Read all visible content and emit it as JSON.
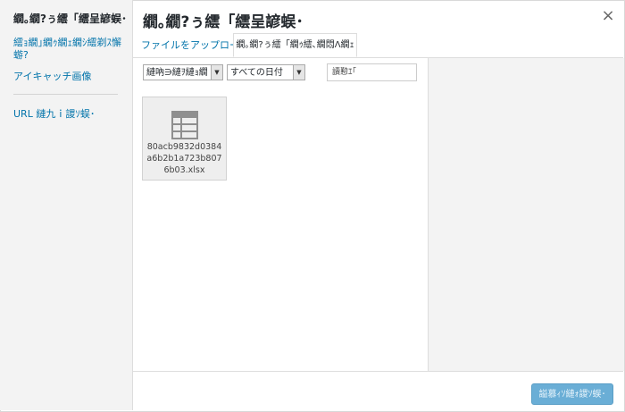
{
  "sidebar": {
    "title": "繝｡繝?ぅ繧「繧呈諺蜈･",
    "links": [
      "繧ｮ繝｣繝ｩ繝ｪ繝ｼ繧剃ｽ懈",
      "蝣?",
      "アイキャッチ画像",
      "URL 縺九ｉ謖ｿ蜈･"
    ]
  },
  "modal": {
    "title": "繝｡繝?ぅ繧「繧呈諺蜈･",
    "close_glyph": "×"
  },
  "tabs": [
    {
      "label": "ファイルをアップロード",
      "active": false
    },
    {
      "label": "繝｡繝?ぅ繧「繝ｩ繧､繝悶Λ繝ｪ",
      "active": true
    }
  ],
  "filters": {
    "type_select": "縺吶∋縺ｦ縺ｮ繝",
    "date_select": "すべての日付",
    "search_value": "讀懃ｴ｢"
  },
  "attachments": [
    {
      "filename": "80acb9832d0384a6b2b1a723b8076b03.xlsx",
      "icon": "spreadsheet-icon"
    }
  ],
  "toolbar": {
    "insert_label": "謚慕ｨｿ縺ｫ謖ｿ蜈･"
  },
  "colors": {
    "link": "#0073aa",
    "button": "#6aaed6",
    "sidebar_bg": "#f3f3f3"
  }
}
